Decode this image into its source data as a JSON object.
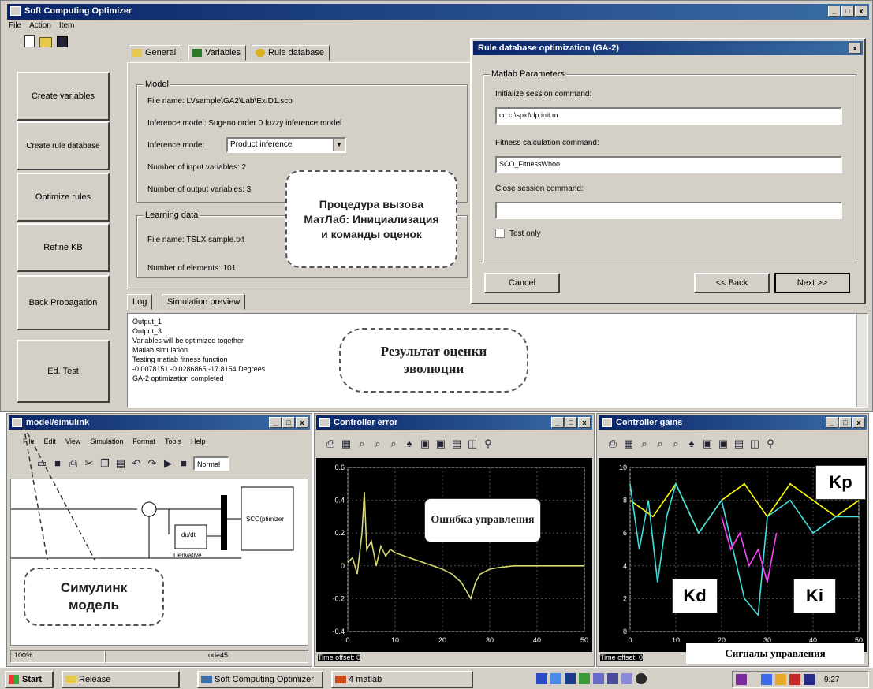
{
  "main_window": {
    "title": "Soft Computing Optimizer",
    "menu": [
      "File",
      "Action",
      "Item"
    ],
    "sidebar_buttons": [
      "Create variables",
      "Create rule database",
      "Optimize rules",
      "Refine KB",
      "Back Propagation",
      "Ed. Test"
    ],
    "tabs": [
      "General",
      "Variables",
      "Rule database"
    ],
    "model_group": {
      "label": "Model",
      "file_name": "File name: LVsample\\GA2\\Lab\\ExID1.sco",
      "inference_model": "Inference model:  Sugeno order 0 fuzzy inference model",
      "inference_mode_label": "Inference mode:",
      "inference_mode_value": "Product inference",
      "num_inputs": "Number of input variables: 2",
      "num_outputs": "Number of output variables: 3"
    },
    "learning_group": {
      "label": "Learning data",
      "file_name": "File name: TSLX sample.txt",
      "num_elements": "Number of elements: 101"
    },
    "log_tabs": [
      "Log",
      "Simulation preview"
    ],
    "log_lines": [
      "Output_1",
      "Output_3",
      "Variables will be optimized together",
      "Matlab simulation",
      "Testing matlab fitness function",
      "-0.0078151 -0.0286865 -17.8154 Degrees",
      "GA-2 optimization completed"
    ]
  },
  "dialog": {
    "title": "Rule database optimization (GA-2)",
    "group_label": "Matlab Parameters",
    "init_label": "Initialize session command:",
    "init_value": "cd c:\\spid\\dp.init.m",
    "fitness_label": "Fitness calculation command:",
    "fitness_value": "SCO_FitnessWhoo",
    "close_label": "Close session command:",
    "close_value": "",
    "test_only": "Test only",
    "cancel": "Cancel",
    "back": "<< Back",
    "next": "Next >>"
  },
  "callouts": {
    "matlab": "Процедура вызова МатЛаб: Инициализация и команды оценок",
    "result": "Результат оценки эволюции",
    "simulink": "Симулинк модель",
    "error": "Ошибка управления",
    "signals": "Сигналы управления"
  },
  "simulink_window": {
    "title": "model/simulink",
    "menu": [
      "File",
      "Edit",
      "View",
      "Simulation",
      "Format",
      "Tools",
      "Help"
    ],
    "mode": "Normal",
    "blocks": {
      "derivative": "du/dt",
      "derivative_label": "Derivative",
      "subsystem": "SCO(ptimizer"
    },
    "status": [
      "100%",
      "ode45"
    ]
  },
  "error_window": {
    "title": "Controller error",
    "time_offset": "Time offset: 0",
    "chart_data": {
      "type": "line",
      "x_ticks": [
        "0",
        "10",
        "20",
        "30",
        "40",
        "50"
      ],
      "y_ticks": [
        "0.6",
        "0.4",
        "0.2",
        "0",
        "-0.2",
        "-0.4"
      ],
      "xlim": [
        0,
        50
      ],
      "ylim": [
        -0.4,
        0.6
      ],
      "series": [
        {
          "color": "#d8d870",
          "x": [
            0,
            1,
            2,
            3,
            3.5,
            4,
            5,
            6,
            7,
            8,
            9,
            10,
            12,
            14,
            16,
            18,
            20,
            22,
            24,
            25,
            26,
            27,
            28,
            30,
            32,
            35,
            40,
            45,
            50
          ],
          "y": [
            0.02,
            0.05,
            -0.05,
            0.2,
            0.45,
            0.1,
            0.15,
            0.0,
            0.12,
            0.06,
            0.1,
            0.08,
            0.06,
            0.04,
            0.02,
            0.0,
            -0.02,
            -0.05,
            -0.1,
            -0.15,
            -0.2,
            -0.1,
            -0.05,
            -0.02,
            -0.01,
            0.0,
            0.0,
            0.0,
            0.0
          ]
        }
      ]
    }
  },
  "gains_window": {
    "title": "Controller gains",
    "time_offset": "Time offset: 0",
    "chart_data": {
      "type": "line",
      "x_ticks": [
        "0",
        "10",
        "20",
        "30",
        "40",
        "50"
      ],
      "y_ticks": [
        "10",
        "8",
        "6",
        "4",
        "2",
        "0"
      ],
      "xlim": [
        0,
        50
      ],
      "ylim": [
        0,
        10
      ],
      "series": [
        {
          "name": "Kp",
          "color": "#ffff00",
          "x": [
            0,
            5,
            10,
            15,
            20,
            25,
            30,
            35,
            40,
            45,
            50
          ],
          "y": [
            8,
            7,
            9,
            6,
            8,
            9,
            7,
            9,
            8,
            7,
            8
          ]
        },
        {
          "name": "Kd",
          "color": "#40e0e0",
          "x": [
            0,
            2,
            4,
            6,
            8,
            10,
            15,
            20,
            25,
            28,
            30,
            35,
            40,
            45,
            50
          ],
          "y": [
            9,
            5,
            8,
            3,
            7,
            9,
            6,
            8,
            2,
            1,
            7,
            8,
            6,
            7,
            7
          ]
        },
        {
          "name": "Ki",
          "color": "#ff40ff",
          "x": [
            20,
            22,
            24,
            26,
            28,
            30,
            32
          ],
          "y": [
            7,
            5,
            6,
            4,
            5,
            3,
            6
          ]
        }
      ]
    }
  },
  "taskbar": {
    "start": "Start",
    "items": [
      "Release",
      "Soft Computing Optimizer",
      "4 matlab"
    ],
    "clock": "9:27"
  }
}
